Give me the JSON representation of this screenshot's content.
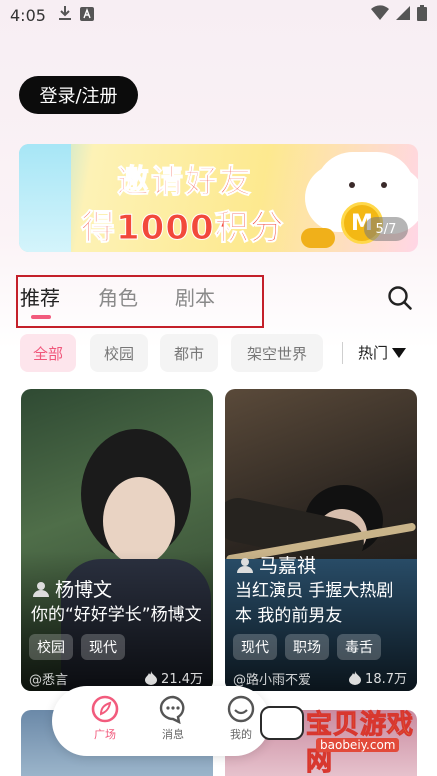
{
  "status_bar": {
    "time": "4:05"
  },
  "login_button": "登录/注册",
  "banner": {
    "line1": "邀请好友",
    "line2": "得1000积分",
    "coin_letter": "M",
    "pager": "5/7"
  },
  "tabs": [
    "推荐",
    "角色",
    "剧本"
  ],
  "active_tab": "推荐",
  "filters": [
    "全部",
    "校园",
    "都市",
    "架空世界"
  ],
  "active_filter": "全部",
  "sort_label": "热门",
  "cards": [
    {
      "name": "杨博文",
      "desc_lines": [
        "你的“好好学长”杨博文"
      ],
      "tags": [
        "校园",
        "现代"
      ],
      "author": "@悉言",
      "likes": "21.4万"
    },
    {
      "name": "马嘉祺",
      "desc_lines": [
        "当红演员 手握大热剧",
        "本 我的前男友"
      ],
      "tags": [
        "现代",
        "职场",
        "毒舌"
      ],
      "author": "@路小雨不爱",
      "likes": "18.7万"
    }
  ],
  "bottom_nav": [
    {
      "label": "广场",
      "icon": "plaza-icon",
      "active": true
    },
    {
      "label": "消息",
      "icon": "message-icon",
      "active": false
    },
    {
      "label": "我的",
      "icon": "profile-icon",
      "active": false
    }
  ],
  "watermark": {
    "title": "宝贝游戏网",
    "url": "baobeiy.com"
  },
  "colors": {
    "accent": "#f25b7d",
    "highlight_box": "#c4202a"
  }
}
